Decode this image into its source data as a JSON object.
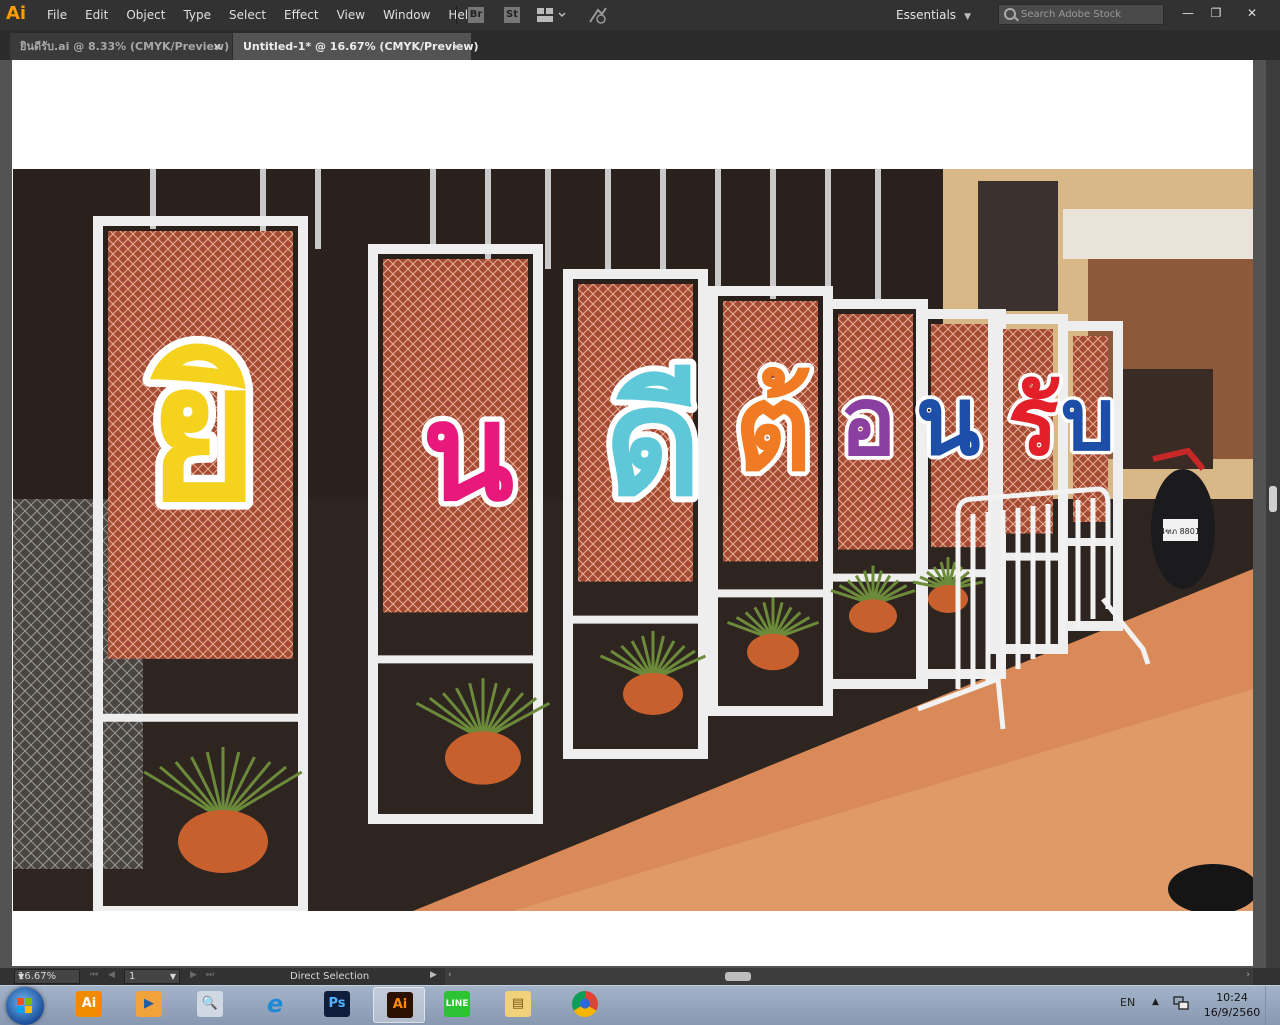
{
  "app": {
    "logo": "Ai"
  },
  "menu": [
    "File",
    "Edit",
    "Object",
    "Type",
    "Select",
    "Effect",
    "View",
    "Window",
    "Help"
  ],
  "toolbar": {
    "bridge": "Br",
    "stock": "St"
  },
  "workspace": {
    "label": "Essentials"
  },
  "search": {
    "placeholder": "Search Adobe Stock"
  },
  "window_controls": {
    "minimize": "—",
    "restore": "❐",
    "close": "✕"
  },
  "tabs": [
    {
      "label": "ยินดีรับ.ai @ 8.33% (CMYK/Preview)",
      "close": "×"
    },
    {
      "label": "Untitled-1* @ 16.67% (CMYK/Preview)",
      "close": "×"
    }
  ],
  "artwork": {
    "letters": [
      "ยิ",
      "น",
      "ดี",
      "ต้",
      "อ",
      "น",
      "รั",
      "บ"
    ],
    "letter_colors": [
      "#f4d21e",
      "#e8197a",
      "#5ec8d8",
      "#f07b22",
      "#8b3fa0",
      "#1d4ea8",
      "#e3202a",
      "#1d4ea8"
    ],
    "mark_colors": [
      "#1d4ea8",
      "#b45aa8",
      "#1f7a3a"
    ],
    "plate": "4ฑภ 8801"
  },
  "status": {
    "zoom": "16.67%",
    "artboard": "1",
    "tool": "Direct Selection",
    "nav": {
      "first": "⏮",
      "prev": "◀",
      "next": "▶",
      "last": "⏭"
    }
  },
  "taskbar": {
    "apps": [
      {
        "name": "illustrator-pinned",
        "label": "Ai",
        "bg": "#f08b00",
        "fg": "#ffffff"
      },
      {
        "name": "media-player",
        "label": "▶",
        "bg": "#f2a23a",
        "fg": "#1e5fa8"
      },
      {
        "name": "search-app",
        "label": "🔍",
        "bg": "#cfd8e3",
        "fg": "#333333"
      },
      {
        "name": "internet-explorer",
        "label": "e",
        "bg": "transparent",
        "fg": "#1e8ad6"
      },
      {
        "name": "photoshop",
        "label": "Ps",
        "bg": "#0f1e3d",
        "fg": "#4fb4ff"
      },
      {
        "name": "illustrator-active",
        "label": "Ai",
        "bg": "#2b1200",
        "fg": "#ff8a00"
      },
      {
        "name": "line",
        "label": "LINE",
        "bg": "#2cc334",
        "fg": "#ffffff"
      },
      {
        "name": "explorer",
        "label": "▤",
        "bg": "#f1d27a",
        "fg": "#7b5a18"
      },
      {
        "name": "chrome",
        "label": "●",
        "bg": "transparent",
        "fg": "#2a6ad8"
      }
    ],
    "tray": {
      "lang": "EN",
      "arrow": "▲",
      "time": "10:24",
      "date": "16/9/2560"
    }
  }
}
